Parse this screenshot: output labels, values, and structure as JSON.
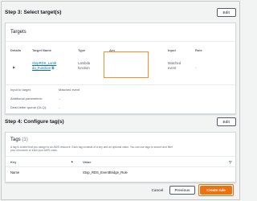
{
  "step3": {
    "title": "Step 3: Select target(s)",
    "edit_label": "Edit",
    "targets_title": "Targets",
    "columns": [
      "Details",
      "Target Name",
      "Type",
      "Arn",
      "Input",
      "Role"
    ],
    "row": {
      "expand_glyph": "▶",
      "target_name_line1": "StopRDS_Lamb",
      "target_name_line2": "da_Function",
      "external_icon": "⧉",
      "type_line1": "Lambda",
      "type_line2": "function",
      "arn": "",
      "input_line1": "Matched",
      "input_line2": "event",
      "role": "-"
    },
    "details": [
      {
        "label": "Input to target:",
        "value": "Matched event"
      },
      {
        "label": "Additional parameters:",
        "value": "--"
      },
      {
        "label": "Dead-letter queue (DLQ):",
        "value": "-"
      }
    ]
  },
  "step4": {
    "title": "Step 4: Configure tag(s)",
    "edit_label": "Edit",
    "tags_title": "Tags",
    "tags_count": "(1)",
    "tags_help_line1": "A tag is a label that you assign to an AWS resource. Each tag consists of a key and an optional value. You can use tags to search and filter",
    "tags_help_line2": "your resources or track your AWS costs.",
    "key_header": "Key",
    "sort_glyph": "▲",
    "value_header": "Value",
    "filter_glyph": "▽",
    "tag_key": "Name",
    "tag_value": "Stop_RDS_EventBridge_Rule"
  },
  "footer": {
    "cancel_label": "Cancel",
    "previous_label": "Previous",
    "create_label": "Create rule"
  },
  "colors": {
    "accent": "#ec7211",
    "highlight": "#f0902f",
    "link": "#0073bb"
  }
}
